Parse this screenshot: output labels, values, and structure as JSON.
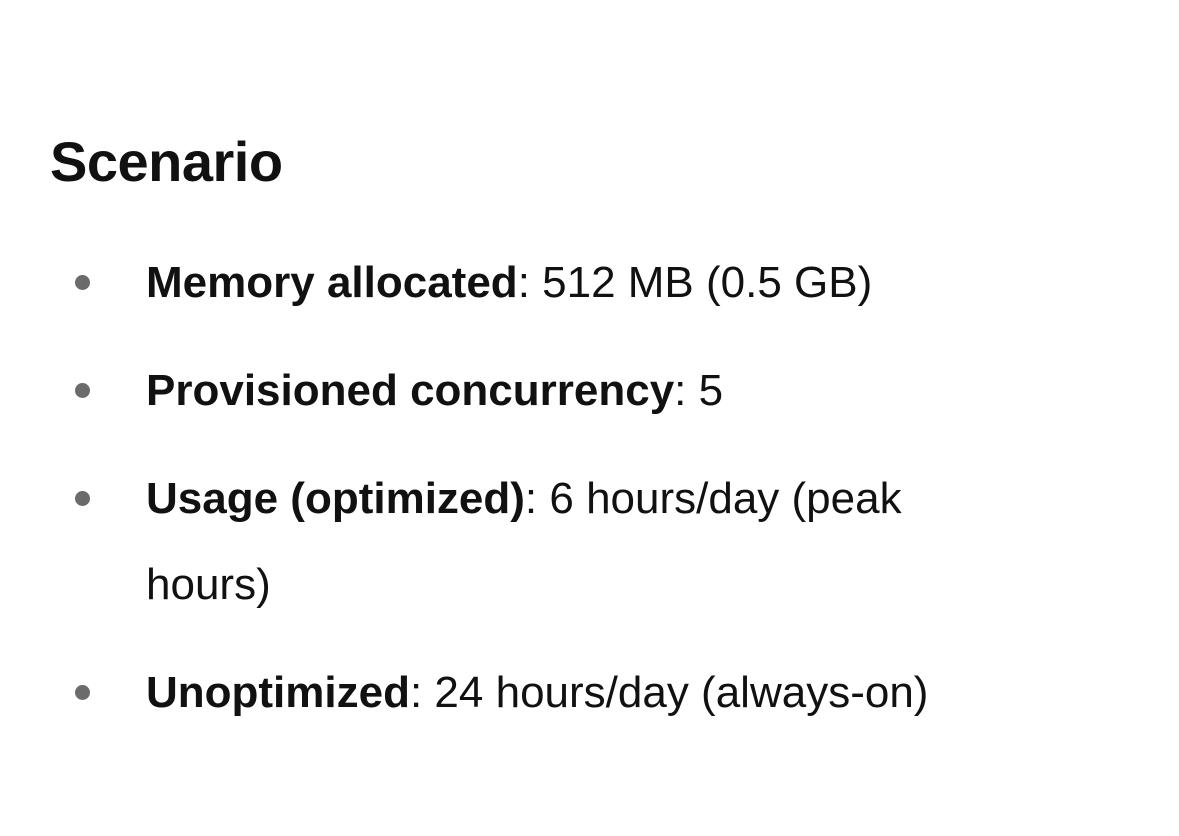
{
  "heading": "Scenario",
  "items": [
    {
      "term": "Memory allocated",
      "desc": ": 512 MB (0.5 GB)"
    },
    {
      "term": "Provisioned concurrency",
      "desc": ": 5"
    },
    {
      "term": "Usage (optimized)",
      "desc": ": 6 hours/day (peak hours)"
    },
    {
      "term": "Unoptimized",
      "desc": ": 24 hours/day (always-on)"
    }
  ]
}
